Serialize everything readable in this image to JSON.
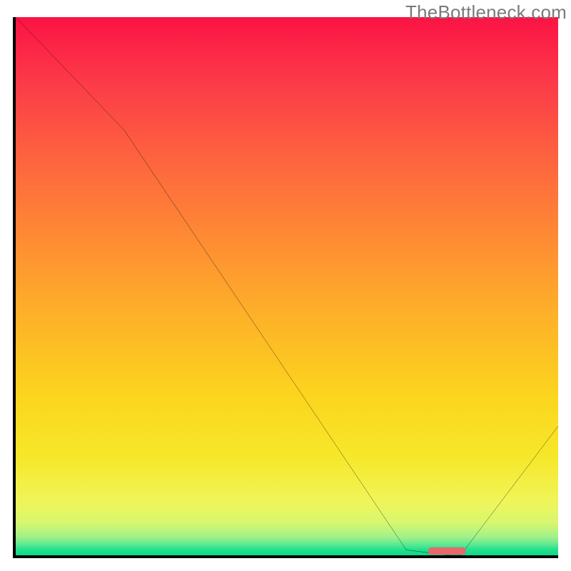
{
  "watermark": "TheBottleneck.com",
  "chart_data": {
    "type": "line",
    "title": "",
    "xlabel": "",
    "ylabel": "",
    "xlim": [
      0,
      100
    ],
    "ylim": [
      0,
      100
    ],
    "grid": false,
    "legend": false,
    "series": [
      {
        "name": "curve",
        "x": [
          0,
          20,
          72,
          80,
          82,
          100
        ],
        "y": [
          100,
          79,
          1,
          0,
          0,
          24
        ]
      }
    ],
    "marker": {
      "name": "highlight",
      "shape": "rounded-bar",
      "x_start": 76,
      "x_end": 83,
      "y": 0.8,
      "color": "#e46a6d"
    },
    "background_gradient": {
      "stops": [
        {
          "pct": 0,
          "color": "#fb1344"
        },
        {
          "pct": 25,
          "color": "#fd6040"
        },
        {
          "pct": 55,
          "color": "#fdb029"
        },
        {
          "pct": 82,
          "color": "#f6e82a"
        },
        {
          "pct": 96,
          "color": "#a4f189"
        },
        {
          "pct": 100,
          "color": "#0fd886"
        }
      ]
    }
  }
}
